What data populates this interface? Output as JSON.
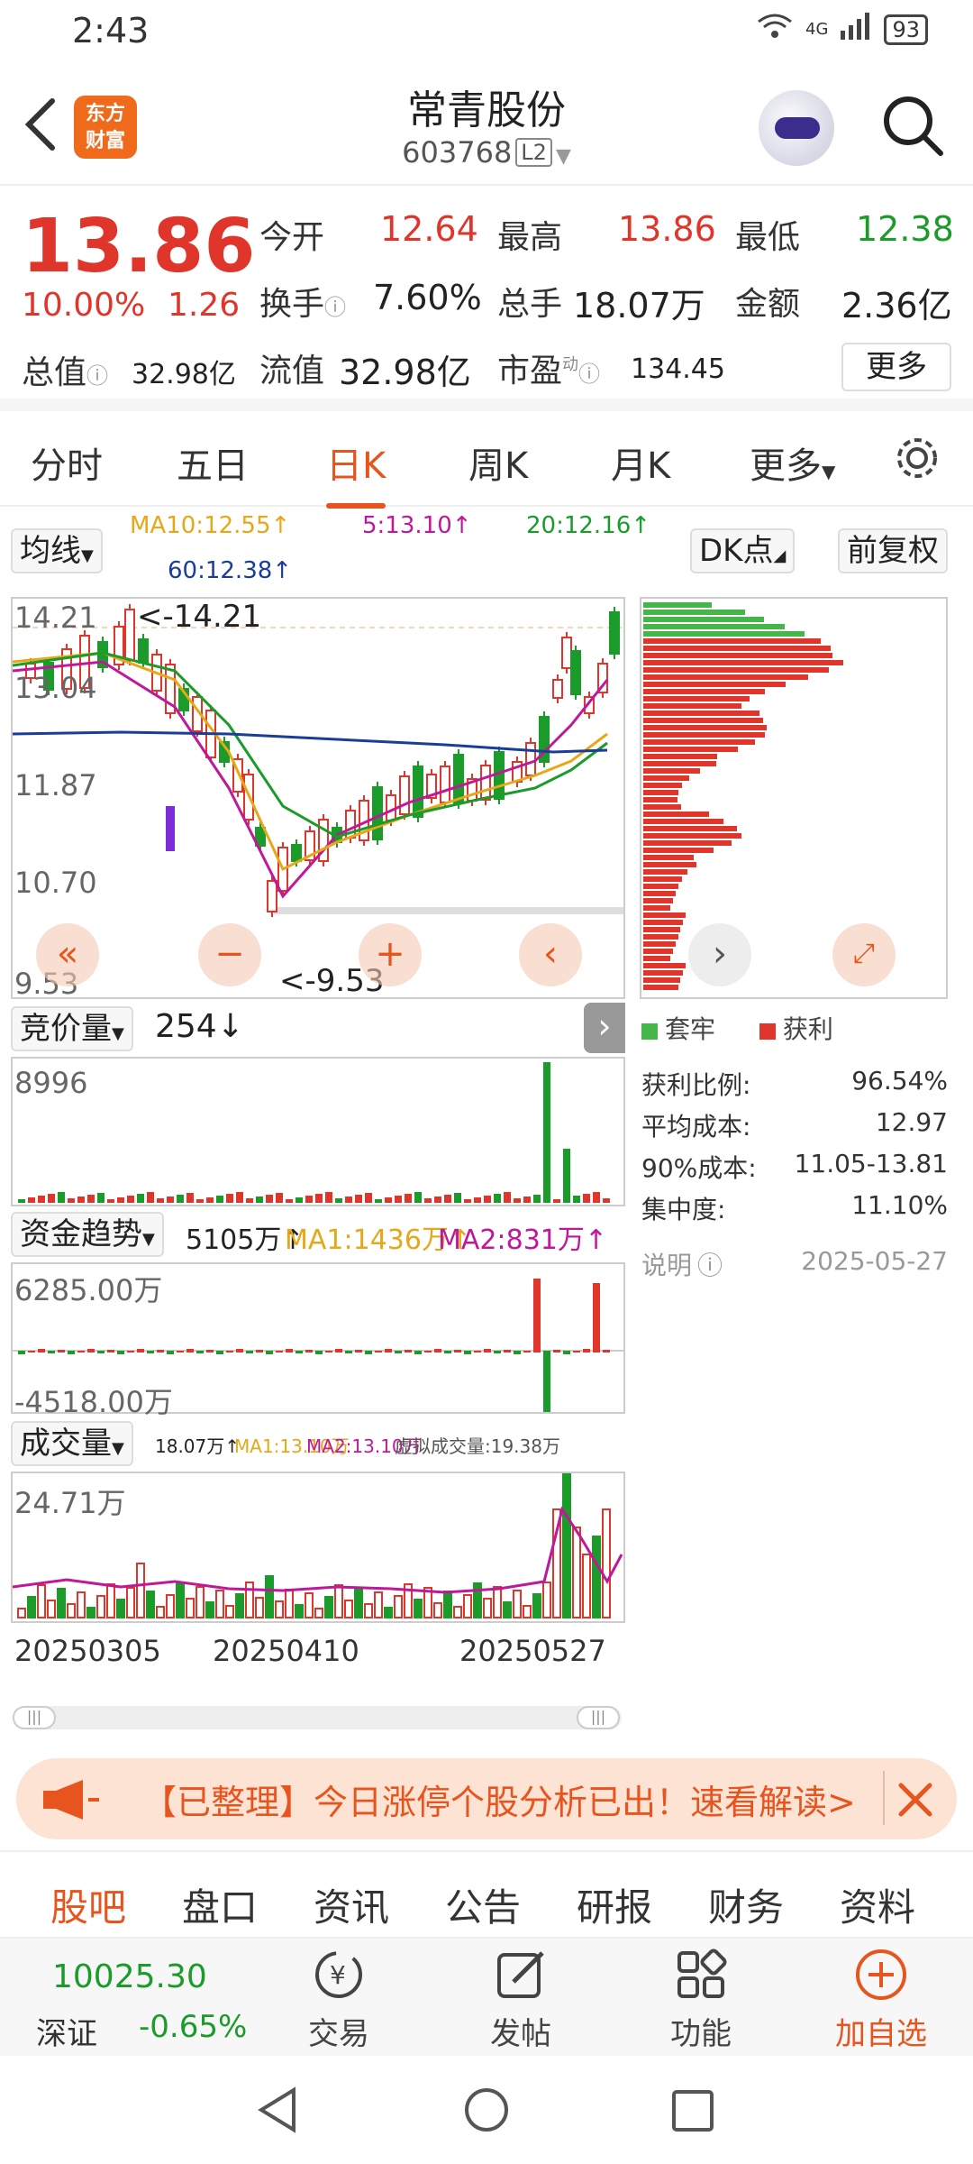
{
  "status": {
    "time": "2:43",
    "network": "4G",
    "battery": "93"
  },
  "header": {
    "title": "常青股份",
    "code": "603768",
    "level": "L2",
    "logo_line1": "东方",
    "logo_line2": "财富"
  },
  "quote": {
    "price": "13.86",
    "change_pct": "10.00%",
    "change": "1.26",
    "open_label": "今开",
    "open": "12.64",
    "high_label": "最高",
    "high": "13.86",
    "low_label": "最低",
    "low": "12.38",
    "turnover_label": "换手",
    "turnover": "7.60%",
    "volume_label": "总手",
    "volume": "18.07万",
    "amount_label": "金额",
    "amount": "2.36亿",
    "mktcap_label": "总值",
    "mktcap": "32.98亿",
    "float_label": "流值",
    "float": "32.98亿",
    "pe_label": "市盈",
    "pe_sup": "动",
    "pe": "134.45",
    "more": "更多"
  },
  "tabs": [
    "分时",
    "五日",
    "日K",
    "周K",
    "月K",
    "更多"
  ],
  "chart_controls": {
    "ma_select": "均线",
    "ma10": "MA10:12.55↑",
    "ma5": "5:13.10↑",
    "ma20": "20:12.16↑",
    "ma60": "60:12.38↑",
    "dk": "DK点",
    "adjust": "前复权"
  },
  "kline": {
    "y_labels": [
      "14.21",
      "13.04",
      "11.87",
      "10.70",
      "9.53"
    ],
    "max_note": "<-14.21",
    "min_note": "<-9.53"
  },
  "volume_panel": {
    "select": "竞价量",
    "value": "254↓",
    "max_label": "8996"
  },
  "fund_panel": {
    "select": "资金趋势",
    "value": "5105万↑",
    "ma1": "MA1:1436万↑",
    "ma2": "MA2:831万↑",
    "top": "6285.00万",
    "bottom": "-4518.00万"
  },
  "cjl_panel": {
    "select": "成交量",
    "value": "18.07万↑",
    "ma1": "MA1:13.10万",
    "ma2": "MA2:13.10万",
    "virtual": "虚拟成交量:19.38万",
    "max_label": "24.71万"
  },
  "dates": [
    "20250305",
    "20250410",
    "20250527"
  ],
  "chips": {
    "legend_trap": "套牢",
    "legend_profit": "获利",
    "stats": [
      {
        "label": "获利比例:",
        "value": "96.54%"
      },
      {
        "label": "平均成本:",
        "value": "12.97"
      },
      {
        "label": "90%成本:",
        "value": "11.05-13.81"
      },
      {
        "label": "集中度:",
        "value": "11.10%"
      }
    ],
    "note_label": "说明",
    "date": "2025-05-27"
  },
  "banner": {
    "text": "【已整理】今日涨停个股分析已出！速看解读>"
  },
  "bottom_tabs": [
    "股吧",
    "盘口",
    "资讯",
    "公告",
    "研报",
    "财务",
    "资料"
  ],
  "toolbar": {
    "index_value": "10025.30",
    "index_name": "深证",
    "index_change": "-0.65%",
    "trade": "交易",
    "post": "发帖",
    "func": "功能",
    "add": "加自选"
  },
  "colors": {
    "up": "#e0352b",
    "down": "#1a9b2a",
    "accent": "#e8541e"
  }
}
